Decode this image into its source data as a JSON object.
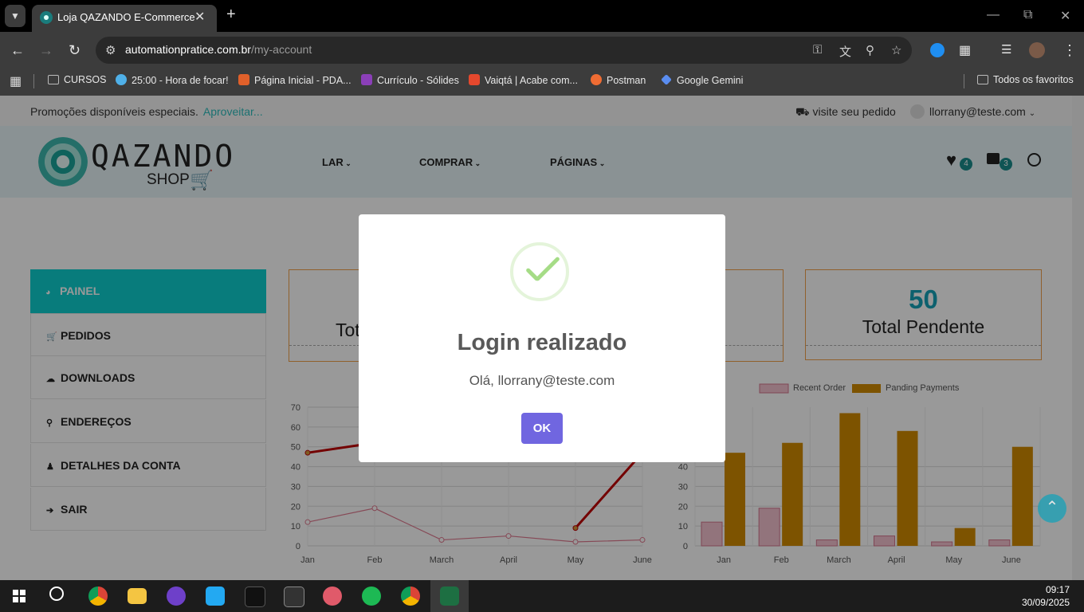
{
  "browser": {
    "tab_title": "Loja QAZANDO E-Commerce",
    "url_host": "automationpratice.com.br",
    "url_path": "/my-account",
    "bookmarks": [
      {
        "label": "CURSOS",
        "color": "#bbbbbb"
      },
      {
        "label": "25:00 - Hora de focar!",
        "color": "#4fb0e8"
      },
      {
        "label": "Página Inicial - PDA...",
        "color": "#e0602a"
      },
      {
        "label": "Currículo - Sólides",
        "color": "#8b3fb8"
      },
      {
        "label": "Vaiqtá | Acabe com...",
        "color": "#e5482d"
      },
      {
        "label": "Postman",
        "color": "#ef6c33"
      },
      {
        "label": "Google Gemini",
        "color": "#5a8df0"
      }
    ],
    "all_bookmarks": "Todos os favoritos"
  },
  "topbar": {
    "promo_text": "Promoções disponíveis especiais.",
    "promo_link": "Aproveitar...",
    "track_order": "visite seu pedido",
    "user_email": "llorrany@teste.com"
  },
  "header": {
    "logo_main": "QAZANDO",
    "logo_sub": "SHOP",
    "menu": [
      "LAR",
      "COMPRAR",
      "PÁGINAS"
    ],
    "wishlist_count": "4",
    "cart_count": "3"
  },
  "sidebar": {
    "items": [
      {
        "label": "PAINEL",
        "icon": "dashboard-icon"
      },
      {
        "label": "PEDIDOS",
        "icon": "cart-icon"
      },
      {
        "label": "DOWNLOADS",
        "icon": "cloud-download-icon"
      },
      {
        "label": "ENDEREÇOS",
        "icon": "map-marker-icon"
      },
      {
        "label": "DETALHES DA CONTA",
        "icon": "user-icon"
      },
      {
        "label": "SAIR",
        "icon": "sign-out-icon"
      }
    ]
  },
  "stats": {
    "box1_label_partial": "Tot",
    "pending_number": "50",
    "pending_label": "Total Pendente"
  },
  "chart_data": [
    {
      "type": "line",
      "categories": [
        "Jan",
        "Feb",
        "March",
        "April",
        "May",
        "June"
      ],
      "ylim": [
        0,
        70
      ],
      "yticks": [
        0,
        10,
        20,
        30,
        40,
        50,
        60,
        70
      ],
      "series": [
        {
          "values": [
            47,
            52,
            null,
            null,
            9,
            47
          ],
          "color": "#c00000"
        },
        {
          "values": [
            12,
            19,
            3,
            5,
            2,
            3
          ],
          "color": "#e07a90"
        }
      ]
    },
    {
      "type": "bar",
      "categories": [
        "Jan",
        "Feb",
        "March",
        "April",
        "May",
        "June"
      ],
      "ylim": [
        0,
        70
      ],
      "yticks": [
        0,
        10,
        20,
        30,
        40
      ],
      "legend_position": "top",
      "series": [
        {
          "name": "Recent Order",
          "values": [
            12,
            19,
            3,
            5,
            2,
            3
          ],
          "color": "#f4c2cf"
        },
        {
          "name": "Panding Payments",
          "values": [
            47,
            52,
            67,
            58,
            9,
            50
          ],
          "color": "#d18a00"
        }
      ]
    }
  ],
  "modal": {
    "title": "Login realizado",
    "text": "Olá, llorrany@teste.com",
    "ok_label": "OK"
  },
  "taskbar": {
    "time": "09:17",
    "date": "30/09/2025"
  }
}
